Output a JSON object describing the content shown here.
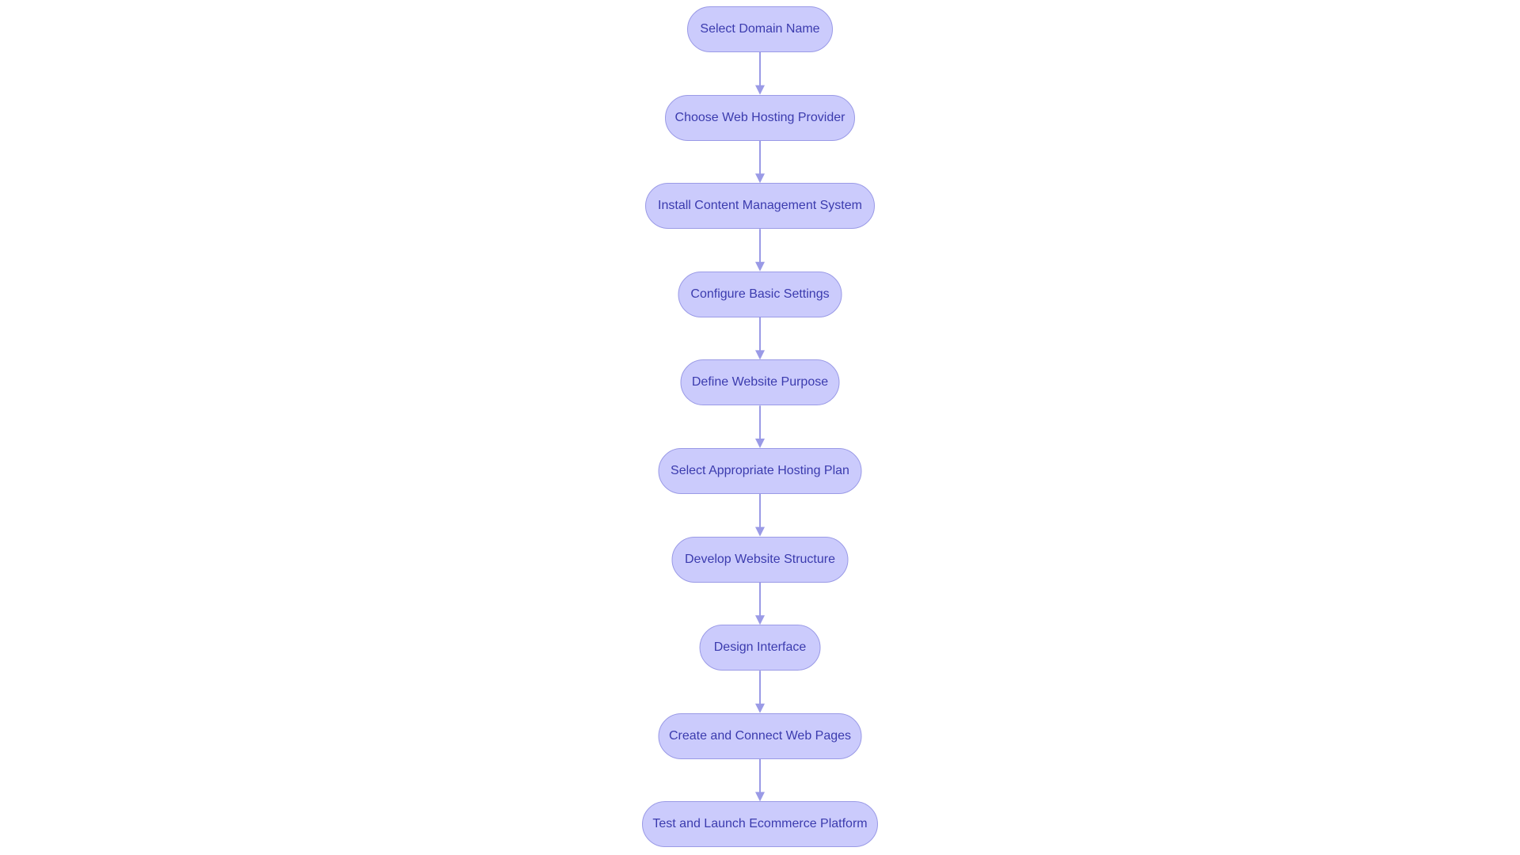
{
  "diagram": {
    "type": "flowchart",
    "direction": "top-to-bottom",
    "colors": {
      "node_fill": "#cbcbfc",
      "node_stroke": "#9a9ae6",
      "text": "#3b3bae",
      "edge": "#9a9ae6"
    },
    "nodes": [
      {
        "label": "Select Domain Name"
      },
      {
        "label": "Choose Web Hosting Provider"
      },
      {
        "label": "Install Content Management System"
      },
      {
        "label": "Configure Basic Settings"
      },
      {
        "label": "Define Website Purpose"
      },
      {
        "label": "Select Appropriate Hosting Plan"
      },
      {
        "label": "Develop Website Structure"
      },
      {
        "label": "Design Interface"
      },
      {
        "label": "Create and Connect Web Pages"
      },
      {
        "label": "Test and Launch Ecommerce Platform"
      }
    ],
    "edges": [
      [
        0,
        1
      ],
      [
        1,
        2
      ],
      [
        2,
        3
      ],
      [
        3,
        4
      ],
      [
        4,
        5
      ],
      [
        5,
        6
      ],
      [
        6,
        7
      ],
      [
        7,
        8
      ],
      [
        8,
        9
      ]
    ]
  }
}
